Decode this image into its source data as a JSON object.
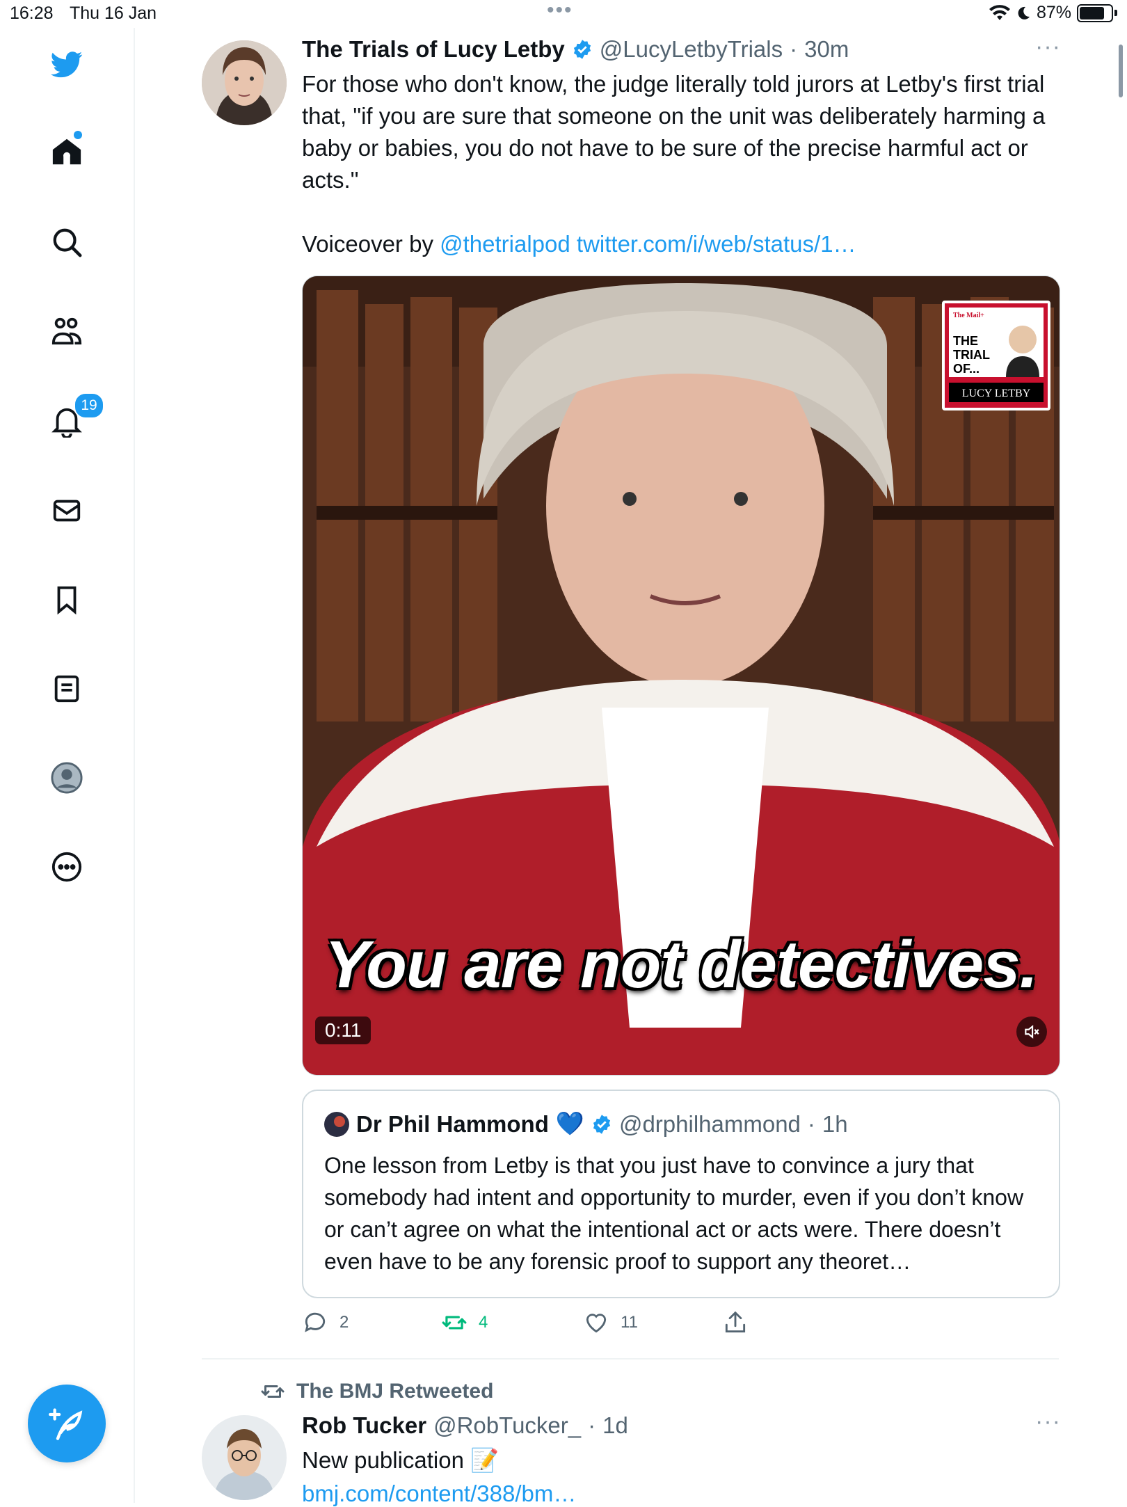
{
  "status_bar": {
    "time": "16:28",
    "date": "Thu 16 Jan",
    "battery": "87%",
    "battery_level": 0.87
  },
  "sidebar": {
    "items": [
      {
        "name": "home",
        "icon": "home-icon"
      },
      {
        "name": "explore",
        "icon": "search-icon"
      },
      {
        "name": "communities",
        "icon": "people-icon"
      },
      {
        "name": "notifications",
        "icon": "bell-icon",
        "badge": "19"
      },
      {
        "name": "messages",
        "icon": "envelope-icon"
      },
      {
        "name": "bookmarks",
        "icon": "bookmark-icon"
      },
      {
        "name": "lists",
        "icon": "list-icon"
      },
      {
        "name": "profile",
        "icon": "profile-avatar"
      },
      {
        "name": "more",
        "icon": "more-circle-icon"
      }
    ],
    "compose_icon": "feather-plus-icon"
  },
  "tweet": {
    "name": "The Trials of Lucy Letby",
    "handle": "@LucyLetbyTrials",
    "sep": "·",
    "time": "30m",
    "text": "For those who don't know, the judge literally told jurors at Letby's first trial that, \"if you are sure that someone on the unit was deliberately harming a baby or babies, you do not have to be sure of the precise harmful act or acts.\"",
    "voiceover_prefix": "Voiceover by",
    "mention": "@thetrialpod",
    "link": "twitter.com/i/web/status/1…",
    "video": {
      "caption": "You are not detectives.",
      "duration": "0:11",
      "logo_lines": [
        "The Mail+",
        "THE",
        "TRIAL",
        "OF...",
        "LUCY LETBY"
      ]
    },
    "quote": {
      "name": "Dr Phil Hammond",
      "emoji": "💙",
      "handle": "@drphilhammond",
      "sep": "·",
      "time": "1h",
      "text": "One lesson from Letby is that you just have to convince a jury that somebody had intent and opportunity to murder, even if you don’t know or can’t agree on what the intentional act or acts were. There doesn’t even have to be any forensic proof to support any theoret…"
    },
    "actions": {
      "replies": "2",
      "retweets": "4",
      "likes": "11"
    }
  },
  "next_tweet": {
    "retweeted_by": "The BMJ Retweeted",
    "name": "Rob Tucker",
    "handle": "@RobTucker_",
    "sep": "·",
    "time": "1d",
    "text": "New publication 📝",
    "link": "bmj.com/content/388/bm…"
  },
  "colors": {
    "accent": "#1d9bf0",
    "retweet_green": "#00ba7c",
    "text": "#0f1419",
    "secondary": "#536471"
  }
}
